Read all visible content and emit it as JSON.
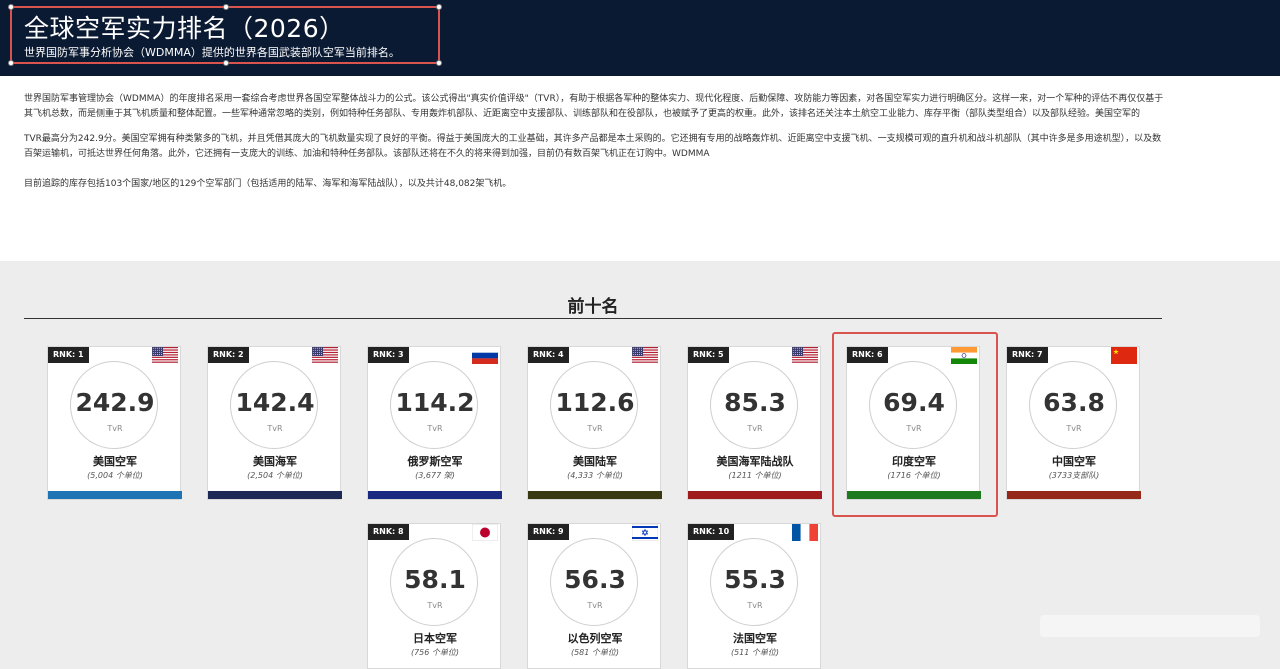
{
  "header": {
    "title": "全球空军实力排名（2026）",
    "subtitle": "世界国防军事分析协会（WDMMA）提供的世界各国武装部队空军当前排名。"
  },
  "intro": {
    "p1": "世界国防军事管理协会（WDMMA）的年度排名采用一套综合考虑世界各国空军整体战斗力的公式。该公式得出\"真实价值评级\"（TVR），有助于根据各军种的整体实力、现代化程度、后勤保障、攻防能力等因素，对各国空军实力进行明确区分。这样一来，对一个军种的评估不再仅仅基于其飞机总数，而是侧重于其飞机质量和整体配置。一些军种通常忽略的类别，例如特种任务部队、专用轰炸机部队、近距离空中支援部队、训练部队和在役部队，也被赋予了更高的权重。此外，该排名还关注本土航空工业能力、库存平衡（部队类型组合）以及部队经验。美国空军的",
    "p2": "TVR最高分为242.9分。美国空军拥有种类繁多的飞机，并且凭借其庞大的飞机数量实现了良好的平衡。得益于美国庞大的工业基础，其许多产品都是本土采购的。它还拥有专用的战略轰炸机、近距离空中支援飞机、一支规模可观的直升机和战斗机部队（其中许多是多用途机型），以及数百架运输机，可抵达世界任何角落。此外，它还拥有一支庞大的训练、加油和特种任务部队。该部队还将在不久的将来得到加强，目前仍有数百架飞机正在订购中。WDMMA",
    "p3": "目前追踪的库存包括103个国家/地区的129个空军部门（包括适用的陆军、海军和海军陆战队），以及共计48,082架飞机。"
  },
  "section_title": "前十名",
  "rank_prefix": "RNK:",
  "tvr_label": "TvR",
  "cards": [
    {
      "rank": "1",
      "score": "242.9",
      "name": "美国空军",
      "units": "(5,004 个单位)",
      "flag": "us-flag-icon",
      "bar_color": "#1f74b4"
    },
    {
      "rank": "2",
      "score": "142.4",
      "name": "美国海军",
      "units": "(2,504 个单位)",
      "flag": "us-flag-icon",
      "bar_color": "#1d2a55"
    },
    {
      "rank": "3",
      "score": "114.2",
      "name": "俄罗斯空军",
      "units": "(3,677 架)",
      "flag": "russia-flag-icon",
      "bar_color": "#1a2a80"
    },
    {
      "rank": "4",
      "score": "112.6",
      "name": "美国陆军",
      "units": "(4,333 个单位)",
      "flag": "us-flag-icon",
      "bar_color": "#3a3a12"
    },
    {
      "rank": "5",
      "score": "85.3",
      "name": "美国海军陆战队",
      "units": "(1211 个单位)",
      "flag": "us-flag-icon",
      "bar_color": "#a01b1b"
    },
    {
      "rank": "6",
      "score": "69.4",
      "name": "印度空军",
      "units": "(1716 个单位)",
      "flag": "india-flag-icon",
      "bar_color": "#1e7a1e"
    },
    {
      "rank": "7",
      "score": "63.8",
      "name": "中国空军",
      "units": "(3733支部队)",
      "flag": "china-flag-icon",
      "bar_color": "#962a1a"
    },
    {
      "rank": "8",
      "score": "58.1",
      "name": "日本空军",
      "units": "(756 个单位)",
      "flag": "japan-flag-icon",
      "bar_color": "#ffffff"
    },
    {
      "rank": "9",
      "score": "56.3",
      "name": "以色列空军",
      "units": "(581 个单位)",
      "flag": "israel-flag-icon",
      "bar_color": "#ffffff"
    },
    {
      "rank": "10",
      "score": "55.3",
      "name": "法国空军",
      "units": "(511 个单位)",
      "flag": "france-flag-icon",
      "bar_color": "#ffffff"
    }
  ]
}
